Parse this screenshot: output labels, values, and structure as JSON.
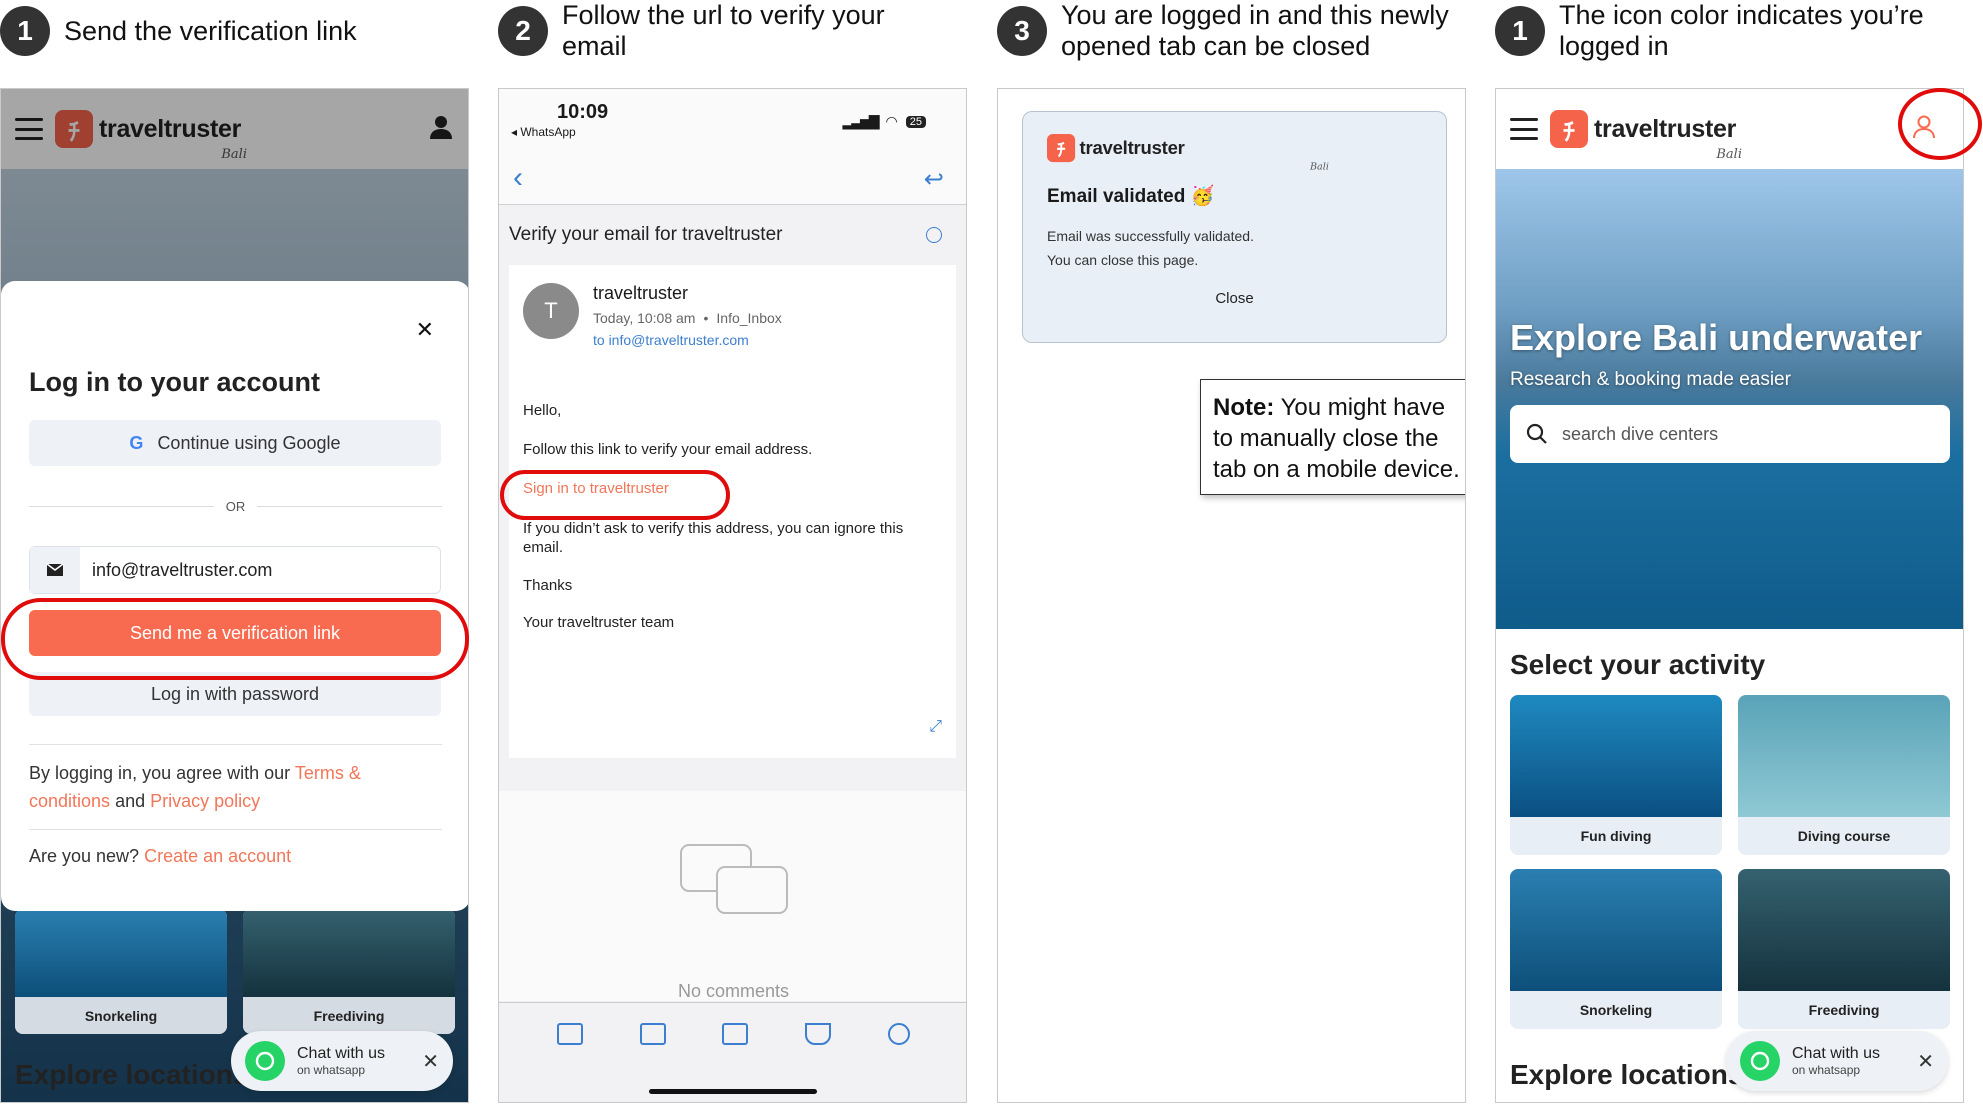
{
  "steps": [
    {
      "num": "1",
      "text": "Send the verification link"
    },
    {
      "num": "2",
      "text": "Follow the url to verify your email"
    },
    {
      "num": "3",
      "text": "You are logged in and this newly opened tab can be closed"
    },
    {
      "num": "1",
      "text": "The icon color indicates you’re logged in"
    }
  ],
  "brand": {
    "name": "traveltruster",
    "sub": "Bali"
  },
  "login": {
    "title": "Log in to your account",
    "google": "Continue using Google",
    "or": "OR",
    "email": "info@traveltruster.com",
    "send": "Send me a verification link",
    "password": "Log in with password",
    "terms_pre": "By logging in, you agree with our ",
    "terms_link": "Terms & conditions",
    "and": " and ",
    "privacy_link": "Privacy policy",
    "new_q": "Are you new? ",
    "create": "Create an account"
  },
  "bg_cards": {
    "snorkeling": "Snorkeling",
    "freediving": "Freediving"
  },
  "explore_locations": "Explore locations",
  "whatsapp": {
    "title": "Chat with us",
    "sub": "on whatsapp"
  },
  "mail": {
    "time": "10:09",
    "back_app": "◂ WhatsApp",
    "battery": "25",
    "subject": "Verify your email for traveltruster",
    "sender": "traveltruster",
    "avatar": "T",
    "date": "Today, 10:08 am",
    "folder": "Info_Inbox",
    "to": "to info@traveltruster.com",
    "hello": "Hello,",
    "follow": "Follow this link to verify your email address.",
    "link": "Sign in to traveltruster",
    "ignore": "If you didn’t ask to verify this address, you can ignore this email.",
    "thanks": "Thanks",
    "team": "Your traveltruster team",
    "no_comments": "No comments"
  },
  "validated": {
    "title": "Email validated 🥳",
    "line1": "Email was successfully validated.",
    "line2": "You can close this page.",
    "close": "Close",
    "note_bold": "Note:",
    "note_text": " You might have to manually close the tab on a mobile device."
  },
  "home": {
    "hero_title": "Explore Bali underwater",
    "hero_sub": "Research & booking made easier",
    "search_placeholder": "search dive centers",
    "select": "Select your activity",
    "cards": [
      "Fun diving",
      "Diving course",
      "Snorkeling",
      "Freediving"
    ]
  },
  "colors": {
    "accent": "#f96b50",
    "highlight": "#e00b0b",
    "link": "#3c7fd0"
  }
}
